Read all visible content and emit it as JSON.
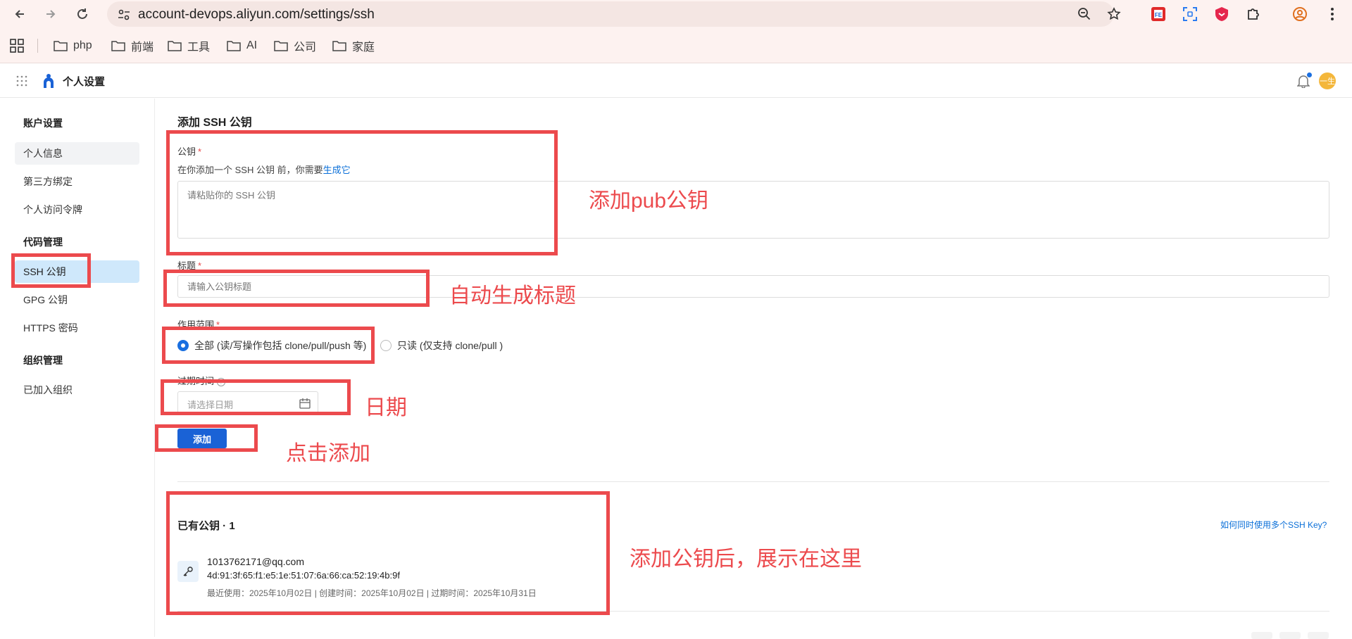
{
  "browser": {
    "url": "account-devops.aliyun.com/settings/ssh",
    "bookmarks": [
      "php",
      "前端",
      "工具",
      "AI",
      "公司",
      "家庭"
    ]
  },
  "app": {
    "title": "个人设置",
    "avatar_text": "一生"
  },
  "sidebar": {
    "groups": [
      {
        "heading": "账户设置",
        "items": [
          "个人信息",
          "第三方绑定",
          "个人访问令牌"
        ]
      },
      {
        "heading": "代码管理",
        "items": [
          "SSH 公钥",
          "GPG 公钥",
          "HTTPS 密码"
        ]
      },
      {
        "heading": "组织管理",
        "items": [
          "已加入组织"
        ]
      }
    ],
    "active_item": "SSH 公钥"
  },
  "form": {
    "section_title": "添加 SSH 公钥",
    "pubkey_label": "公钥",
    "required_mark": "*",
    "pubkey_help": "在你添加一个 SSH 公钥 前，你需要",
    "pubkey_help_link": "生成它",
    "pubkey_placeholder": "请粘贴你的 SSH 公钥",
    "title_label": "标题",
    "title_placeholder": "请输入公钥标题",
    "scope_label": "作用范围",
    "scope_options": [
      {
        "label": "全部 (读/写操作包括 clone/pull/push 等)",
        "checked": true
      },
      {
        "label": "只读 (仅支持 clone/pull )",
        "checked": false
      }
    ],
    "expiry_label": "过期时间",
    "expiry_placeholder": "请选择日期",
    "submit_label": "添加"
  },
  "keys": {
    "heading": "已有公钥 · 1",
    "help_link": "如何同时使用多个SSH Key?",
    "items": [
      {
        "email": "1013762171@qq.com",
        "fingerprint": "4d:91:3f:65:f1:e5:1e:51:07:6a:66:ca:52:19:4b:9f",
        "meta": "最近使用：2025年10月02日  |  创建时间：2025年10月02日  |  过期时间：2025年10月31日"
      }
    ]
  },
  "annotations": {
    "pubkey": "添加pub公钥",
    "title": "自动生成标题",
    "date": "日期",
    "add": "点击添加",
    "list": "添加公钥后，展示在这里"
  },
  "colors": {
    "annotation_red": "#ec4a4d",
    "primary_blue": "#1a62d6",
    "active_bg": "#cfe8fb"
  }
}
